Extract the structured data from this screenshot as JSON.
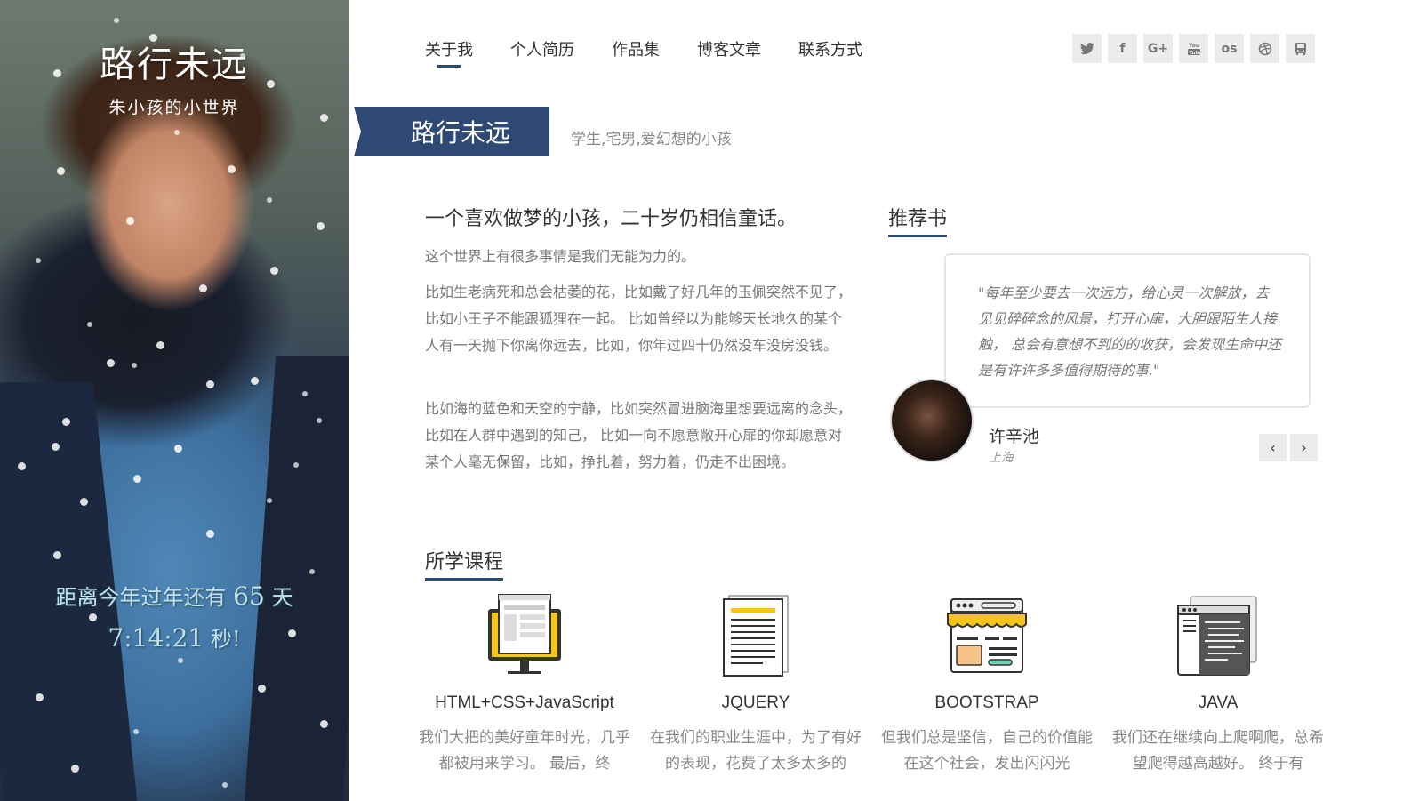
{
  "side": {
    "title": "路行未远",
    "subtitle": "朱小孩的小世界",
    "countdown_prefix": "距离今年过年还有",
    "countdown_days": "65",
    "countdown_days_unit": "天",
    "countdown_time": "7:14:21",
    "countdown_seconds_unit": "秒!"
  },
  "nav": {
    "items": [
      "关于我",
      "个人简历",
      "作品集",
      "博客文章",
      "联系方式"
    ],
    "active_index": 0
  },
  "social": {
    "icons": [
      {
        "name": "twitter-icon",
        "glyph": "🐦"
      },
      {
        "name": "facebook-icon",
        "glyph": "f"
      },
      {
        "name": "google-plus-icon",
        "glyph": "G+"
      },
      {
        "name": "youtube-icon",
        "glyph": "▶"
      },
      {
        "name": "lastfm-icon",
        "glyph": "os"
      },
      {
        "name": "dribbble-icon",
        "glyph": "⊕"
      },
      {
        "name": "bus-icon",
        "glyph": "🚌"
      }
    ]
  },
  "banner": {
    "title": "路行未远",
    "subtitle": "学生,宅男,爱幻想的小孩"
  },
  "about": {
    "heading": "一个喜欢做梦的小孩，二十岁仍相信童话。",
    "paragraphs": [
      "这个世界上有很多事情是我们无能为力的。",
      "比如生老病死和总会枯萎的花，比如戴了好几年的玉佩突然不见了，比如小王子不能跟狐狸在一起。 比如曾经以为能够天长地久的某个人有一天抛下你离你远去，比如，你年过四十仍然没车没房没钱。",
      "比如海的蓝色和天空的宁静，比如突然冒进脑海里想要远离的念头，比如在人群中遇到的知己， 比如一向不愿意敞开心扉的你却愿意对某个人毫无保留，比如，挣扎着，努力着，仍走不出困境。"
    ]
  },
  "books": {
    "heading": "推荐书",
    "quote": "\"每年至少要去一次远方，给心灵一次解放，去见见碎碎念的风景，打开心扉，大胆跟陌生人接触， 总会有意想不到的的收获，会发现生命中还是有许许多多值得期待的事.\"",
    "author": "许辛池",
    "place": "上海",
    "prev": "‹",
    "next": "›"
  },
  "courses": {
    "heading": "所学课程",
    "items": [
      {
        "name": "HTML+CSS+JavaScript",
        "icon": "monitor-icon",
        "desc": "我们大把的美好童年时光，几乎都被用来学习。 最后，终"
      },
      {
        "name": "JQUERY",
        "icon": "document-icon",
        "desc": "在我们的职业生涯中，为了有好的表现，花费了太多太多的"
      },
      {
        "name": "BOOTSTRAP",
        "icon": "storefront-icon",
        "desc": "但我们总是坚信，自己的价值能在这个社会，发出闪闪光"
      },
      {
        "name": "JAVA",
        "icon": "code-window-icon",
        "desc": "我们还在继续向上爬啊爬，总希望爬得越高越好。 终于有"
      }
    ]
  },
  "colors": {
    "accent": "#2e4a74",
    "countdown": "#bfe3ee",
    "icon_yellow": "#f5c518"
  }
}
